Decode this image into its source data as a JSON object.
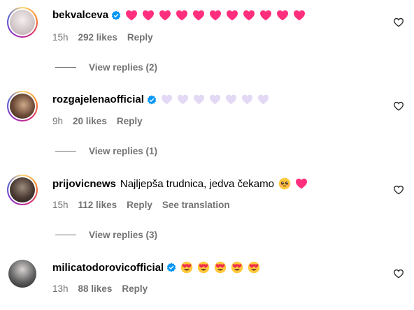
{
  "comments": [
    {
      "username": "bekvalceva",
      "verified": true,
      "text": "",
      "emoji_count": 11,
      "emoji_kind": "pink-heart",
      "time": "15h",
      "likes": "292 likes",
      "reply": "Reply",
      "view_replies": "View replies (2)"
    },
    {
      "username": "rozgajelenaofficial",
      "verified": true,
      "text": "",
      "emoji_count": 7,
      "emoji_kind": "lilac-heart",
      "time": "9h",
      "likes": "20 likes",
      "reply": "Reply",
      "view_replies": "View replies (1)"
    },
    {
      "username": "prijovicnews",
      "verified": false,
      "text": "Najljepša trudnica, jedva čekamo",
      "emoji_kind": "mixed",
      "time": "15h",
      "likes": "112 likes",
      "reply": "Reply",
      "see_translation": "See translation",
      "view_replies": "View replies (3)"
    },
    {
      "username": "milicatodorovicofficial",
      "verified": true,
      "text": "",
      "emoji_count": 5,
      "emoji_kind": "heart-eyes",
      "time": "13h",
      "likes": "88 likes",
      "reply": "Reply"
    }
  ],
  "colors": {
    "verified": "#0095f6",
    "pink_heart": "#ff2f7d",
    "lilac_heart": "#e4d9f4",
    "meta_text": "#737373"
  },
  "icons": {
    "like": "heart-outline-icon"
  }
}
